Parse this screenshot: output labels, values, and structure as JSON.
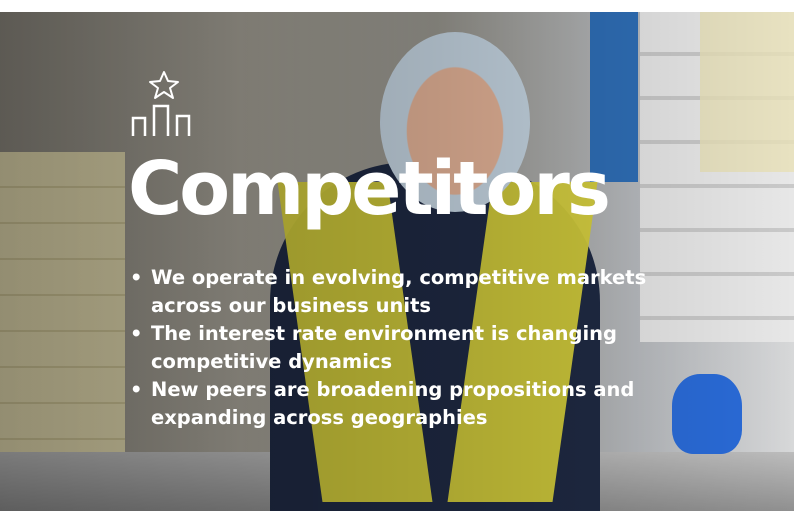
{
  "slide": {
    "title": "Competitors",
    "icon": "podium-star-icon",
    "bullets": [
      "We operate in evolving, competitive markets across our business units",
      "The interest rate environment is changing competitive dynamics",
      "New peers are broadening propositions and expanding across geographies"
    ]
  },
  "colors": {
    "text": "#ffffff",
    "vest": "#d9d23b",
    "glove": "#2a6bd8"
  }
}
